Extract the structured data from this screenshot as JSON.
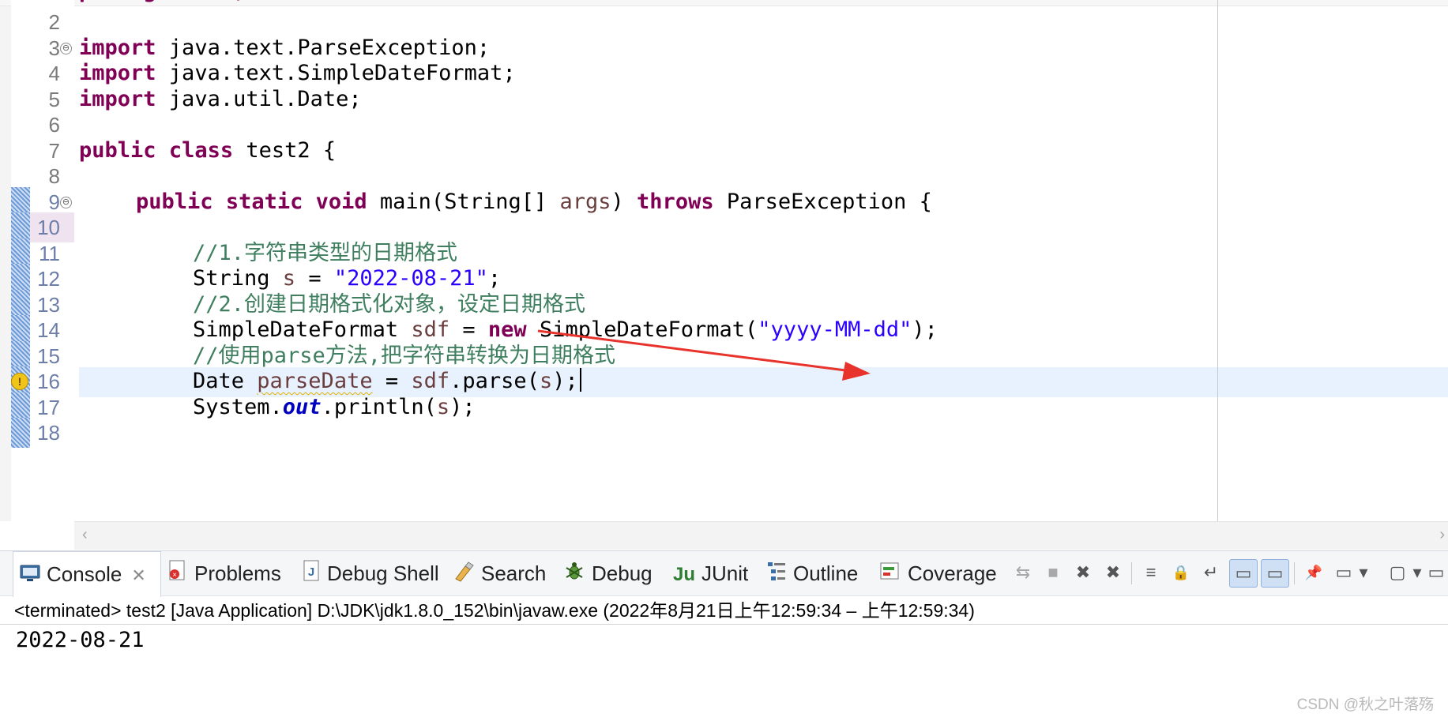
{
  "editor": {
    "partial_top_line": "package test;",
    "gutter": [
      {
        "n": "2"
      },
      {
        "n": "3",
        "fold": "⊖"
      },
      {
        "n": "4"
      },
      {
        "n": "5"
      },
      {
        "n": "6"
      },
      {
        "n": "7"
      },
      {
        "n": "8"
      },
      {
        "n": "9",
        "fold": "⊖"
      },
      {
        "n": "10"
      },
      {
        "n": "11"
      },
      {
        "n": "12"
      },
      {
        "n": "13"
      },
      {
        "n": "14"
      },
      {
        "n": "15"
      },
      {
        "n": "16",
        "warning": "!"
      },
      {
        "n": "17"
      },
      {
        "n": "18"
      }
    ],
    "lines": [
      {
        "kw_import": "import",
        "t": " java.text.ParseException;"
      },
      {
        "kw_import": "import",
        "t": " java.text.SimpleDateFormat;"
      },
      {
        "kw_import": "import",
        "t": " java.util.Date;"
      },
      {
        "kw1": "public",
        "kw2": "class",
        "t": " test2 {"
      },
      {
        "kw1": "public",
        "kw2": "static",
        "kw3": "void",
        "t1": " main(String[] ",
        "var": "args",
        "t2": ") ",
        "kw4": "throws",
        "t3": " ParseException {"
      },
      {
        "cmt": "//1.字符串类型的日期格式"
      },
      {
        "t1": "String ",
        "var": "s",
        "t2": " = ",
        "str": "\"2022-08-21\"",
        "t3": ";"
      },
      {
        "cmt": "//2.创建日期格式化对象，设定日期格式"
      },
      {
        "t1": "SimpleDateFormat ",
        "var": "sdf",
        "t2": " = ",
        "kw": "new",
        "t3": " SimpleDateFormat(",
        "str": "\"yyyy-MM-dd\"",
        "t4": ");"
      },
      {
        "cmt": "//使用parse方法,把字符串转换为日期格式"
      },
      {
        "t1": "Date ",
        "var": "parseDate",
        "t2": " = ",
        "var2": "sdf",
        "t3": ".parse(",
        "var3": "s",
        "t4": ");"
      },
      {
        "t1": "System.",
        "fld": "out",
        "t2": ".println(",
        "var": "s",
        "t3": ");"
      }
    ]
  },
  "console": {
    "tabs": [
      {
        "label": "Console",
        "icon": "console-icon",
        "active": true,
        "close": "✕"
      },
      {
        "label": "Problems",
        "icon": "problems-icon"
      },
      {
        "label": "Debug Shell",
        "icon": "debug-shell-icon"
      },
      {
        "label": "Search",
        "icon": "search-icon"
      },
      {
        "label": "Debug",
        "icon": "debug-icon"
      },
      {
        "label": "JUnit",
        "icon": "junit-icon",
        "icon_text": "Ju"
      },
      {
        "label": "Outline",
        "icon": "outline-icon"
      },
      {
        "label": "Coverage",
        "icon": "coverage-icon"
      }
    ],
    "toolbar_glyphs": {
      "disconnect": "⇆",
      "terminate": "■",
      "remove-launch": "✖",
      "remove-all": "✖",
      "clear": "≡",
      "scroll-lock": "🔒",
      "word-wrap": "↵",
      "show-stdout": "▭",
      "show-stderr": "▭",
      "pin": "📌",
      "display-console": "▭",
      "dropdown": "▾",
      "new-console": "▢",
      "view-menu": "▾",
      "minimize": "▭"
    },
    "status": "<terminated> test2 [Java Application] D:\\JDK\\jdk1.8.0_152\\bin\\javaw.exe  (2022年8月21日上午12:59:34 – 上午12:59:34)",
    "output": "2022-08-21",
    "watermark": "CSDN @秋之叶落殇"
  },
  "colors": {
    "keyword": "#7f0055",
    "string": "#2a00ff",
    "comment": "#3f7f5f",
    "variable": "#6a3e3e",
    "field": "#0000c0",
    "annotation_arrow": "#e8332c",
    "current_line": "#e8f2fe"
  }
}
